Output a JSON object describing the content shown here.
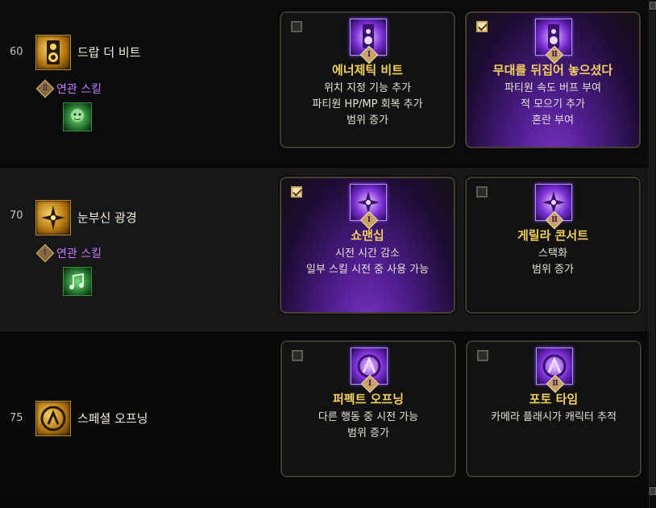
{
  "rows": [
    {
      "level": "60",
      "skill_name": "드랍 더 비트",
      "skill_icon": "speaker-icon",
      "related_label": "연관 스킬",
      "related_badge": "Ⅱ",
      "related_icon": "green-face-icon",
      "cards": [
        {
          "badge": "Ⅰ",
          "checked": false,
          "selected": false,
          "title": "에너제틱 비트",
          "desc": [
            "위치 지정 기능 추가",
            "파티원 HP/MP 회복 추가",
            "범위 증가"
          ]
        },
        {
          "badge": "Ⅱ",
          "checked": true,
          "selected": true,
          "title": "무대를 뒤집어 놓으셨다",
          "desc": [
            "파티원 속도 버프 부여",
            "적 모으기 추가",
            "혼란 부여"
          ]
        }
      ]
    },
    {
      "level": "70",
      "skill_name": "눈부신 광경",
      "skill_icon": "sparkle-icon",
      "related_label": "연관 스킬",
      "related_badge": "Ⅰ",
      "related_icon": "green-note-icon",
      "cards": [
        {
          "badge": "Ⅰ",
          "checked": true,
          "selected": true,
          "title": "쇼맨십",
          "desc": [
            "시전 시간 감소",
            "일부 스킬 시전 중 사용 가능"
          ]
        },
        {
          "badge": "Ⅱ",
          "checked": false,
          "selected": false,
          "title": "게릴라 콘서트",
          "desc": [
            "스택화",
            "범위 증가"
          ]
        }
      ]
    },
    {
      "level": "75",
      "skill_name": "스페셜 오프닝",
      "skill_icon": "hand-gesture-icon",
      "cards": [
        {
          "badge": "Ⅰ",
          "checked": false,
          "selected": false,
          "title": "퍼펙트 오프닝",
          "desc": [
            "다른 행동 중 시전 가능",
            "범위 증가"
          ]
        },
        {
          "badge": "Ⅱ",
          "checked": false,
          "selected": false,
          "title": "포토 타임",
          "desc": [
            "카메라 플래시가 캐릭터 추적"
          ]
        }
      ]
    }
  ],
  "colors": {
    "title_gold": "#f2cf60",
    "related_purple": "#c779ff",
    "selected_purple": "#7c35c9"
  }
}
